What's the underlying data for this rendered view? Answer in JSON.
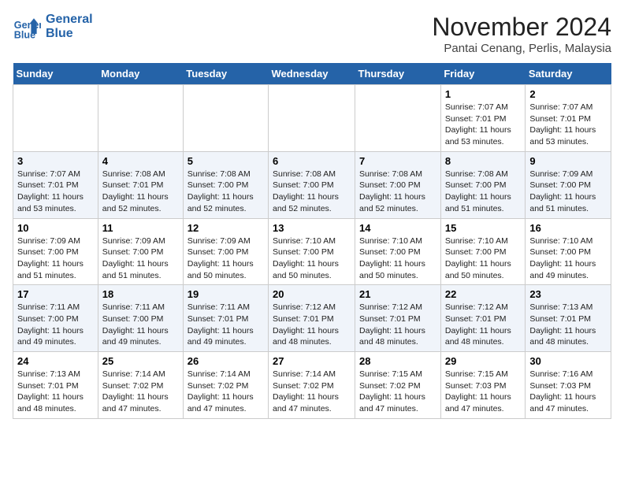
{
  "header": {
    "logo_line1": "General",
    "logo_line2": "Blue",
    "month": "November 2024",
    "location": "Pantai Cenang, Perlis, Malaysia"
  },
  "days_of_week": [
    "Sunday",
    "Monday",
    "Tuesday",
    "Wednesday",
    "Thursday",
    "Friday",
    "Saturday"
  ],
  "weeks": [
    [
      {
        "day": "",
        "info": ""
      },
      {
        "day": "",
        "info": ""
      },
      {
        "day": "",
        "info": ""
      },
      {
        "day": "",
        "info": ""
      },
      {
        "day": "",
        "info": ""
      },
      {
        "day": "1",
        "info": "Sunrise: 7:07 AM\nSunset: 7:01 PM\nDaylight: 11 hours\nand 53 minutes."
      },
      {
        "day": "2",
        "info": "Sunrise: 7:07 AM\nSunset: 7:01 PM\nDaylight: 11 hours\nand 53 minutes."
      }
    ],
    [
      {
        "day": "3",
        "info": "Sunrise: 7:07 AM\nSunset: 7:01 PM\nDaylight: 11 hours\nand 53 minutes."
      },
      {
        "day": "4",
        "info": "Sunrise: 7:08 AM\nSunset: 7:01 PM\nDaylight: 11 hours\nand 52 minutes."
      },
      {
        "day": "5",
        "info": "Sunrise: 7:08 AM\nSunset: 7:00 PM\nDaylight: 11 hours\nand 52 minutes."
      },
      {
        "day": "6",
        "info": "Sunrise: 7:08 AM\nSunset: 7:00 PM\nDaylight: 11 hours\nand 52 minutes."
      },
      {
        "day": "7",
        "info": "Sunrise: 7:08 AM\nSunset: 7:00 PM\nDaylight: 11 hours\nand 52 minutes."
      },
      {
        "day": "8",
        "info": "Sunrise: 7:08 AM\nSunset: 7:00 PM\nDaylight: 11 hours\nand 51 minutes."
      },
      {
        "day": "9",
        "info": "Sunrise: 7:09 AM\nSunset: 7:00 PM\nDaylight: 11 hours\nand 51 minutes."
      }
    ],
    [
      {
        "day": "10",
        "info": "Sunrise: 7:09 AM\nSunset: 7:00 PM\nDaylight: 11 hours\nand 51 minutes."
      },
      {
        "day": "11",
        "info": "Sunrise: 7:09 AM\nSunset: 7:00 PM\nDaylight: 11 hours\nand 51 minutes."
      },
      {
        "day": "12",
        "info": "Sunrise: 7:09 AM\nSunset: 7:00 PM\nDaylight: 11 hours\nand 50 minutes."
      },
      {
        "day": "13",
        "info": "Sunrise: 7:10 AM\nSunset: 7:00 PM\nDaylight: 11 hours\nand 50 minutes."
      },
      {
        "day": "14",
        "info": "Sunrise: 7:10 AM\nSunset: 7:00 PM\nDaylight: 11 hours\nand 50 minutes."
      },
      {
        "day": "15",
        "info": "Sunrise: 7:10 AM\nSunset: 7:00 PM\nDaylight: 11 hours\nand 50 minutes."
      },
      {
        "day": "16",
        "info": "Sunrise: 7:10 AM\nSunset: 7:00 PM\nDaylight: 11 hours\nand 49 minutes."
      }
    ],
    [
      {
        "day": "17",
        "info": "Sunrise: 7:11 AM\nSunset: 7:00 PM\nDaylight: 11 hours\nand 49 minutes."
      },
      {
        "day": "18",
        "info": "Sunrise: 7:11 AM\nSunset: 7:00 PM\nDaylight: 11 hours\nand 49 minutes."
      },
      {
        "day": "19",
        "info": "Sunrise: 7:11 AM\nSunset: 7:01 PM\nDaylight: 11 hours\nand 49 minutes."
      },
      {
        "day": "20",
        "info": "Sunrise: 7:12 AM\nSunset: 7:01 PM\nDaylight: 11 hours\nand 48 minutes."
      },
      {
        "day": "21",
        "info": "Sunrise: 7:12 AM\nSunset: 7:01 PM\nDaylight: 11 hours\nand 48 minutes."
      },
      {
        "day": "22",
        "info": "Sunrise: 7:12 AM\nSunset: 7:01 PM\nDaylight: 11 hours\nand 48 minutes."
      },
      {
        "day": "23",
        "info": "Sunrise: 7:13 AM\nSunset: 7:01 PM\nDaylight: 11 hours\nand 48 minutes."
      }
    ],
    [
      {
        "day": "24",
        "info": "Sunrise: 7:13 AM\nSunset: 7:01 PM\nDaylight: 11 hours\nand 48 minutes."
      },
      {
        "day": "25",
        "info": "Sunrise: 7:14 AM\nSunset: 7:02 PM\nDaylight: 11 hours\nand 47 minutes."
      },
      {
        "day": "26",
        "info": "Sunrise: 7:14 AM\nSunset: 7:02 PM\nDaylight: 11 hours\nand 47 minutes."
      },
      {
        "day": "27",
        "info": "Sunrise: 7:14 AM\nSunset: 7:02 PM\nDaylight: 11 hours\nand 47 minutes."
      },
      {
        "day": "28",
        "info": "Sunrise: 7:15 AM\nSunset: 7:02 PM\nDaylight: 11 hours\nand 47 minutes."
      },
      {
        "day": "29",
        "info": "Sunrise: 7:15 AM\nSunset: 7:03 PM\nDaylight: 11 hours\nand 47 minutes."
      },
      {
        "day": "30",
        "info": "Sunrise: 7:16 AM\nSunset: 7:03 PM\nDaylight: 11 hours\nand 47 minutes."
      }
    ]
  ]
}
